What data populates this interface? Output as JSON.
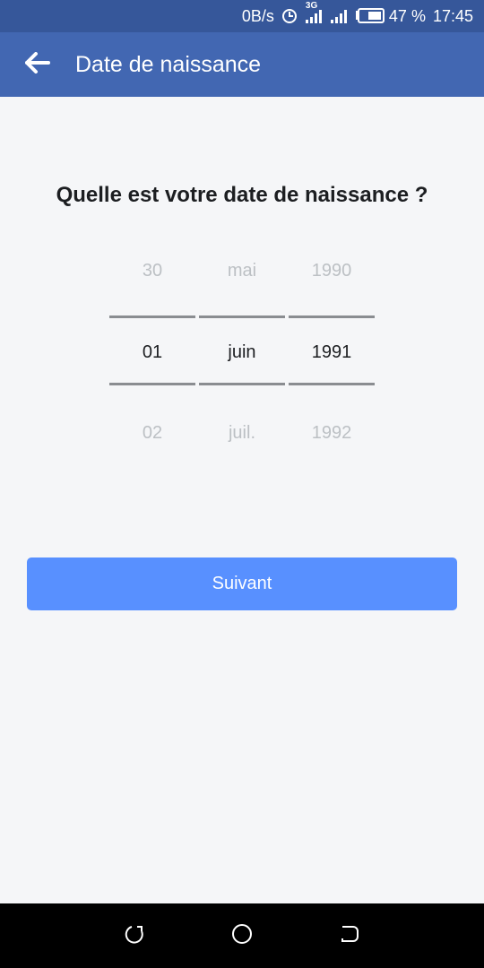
{
  "status_bar": {
    "net_speed": "0B/s",
    "network_type": "3G",
    "battery": "47 %",
    "time": "17:45"
  },
  "app_bar": {
    "back_icon": "arrow-left-icon",
    "title": "Date de naissance"
  },
  "question": "Quelle est votre date de naissance ?",
  "picker": {
    "day": {
      "prev": "30",
      "selected": "01",
      "next": "02"
    },
    "month": {
      "prev": "mai",
      "selected": "juin",
      "next": "juil."
    },
    "year": {
      "prev": "1990",
      "selected": "1991",
      "next": "1992"
    }
  },
  "next_button": {
    "label": "Suivant"
  },
  "nav_bar": {
    "back_icon": "back-nav-icon",
    "home_icon": "home-nav-icon",
    "recents_icon": "recents-nav-icon"
  },
  "colors": {
    "status_bar": "#36579a",
    "app_bar": "#4267b2",
    "button": "#5890ff",
    "background": "#f5f6f8"
  }
}
